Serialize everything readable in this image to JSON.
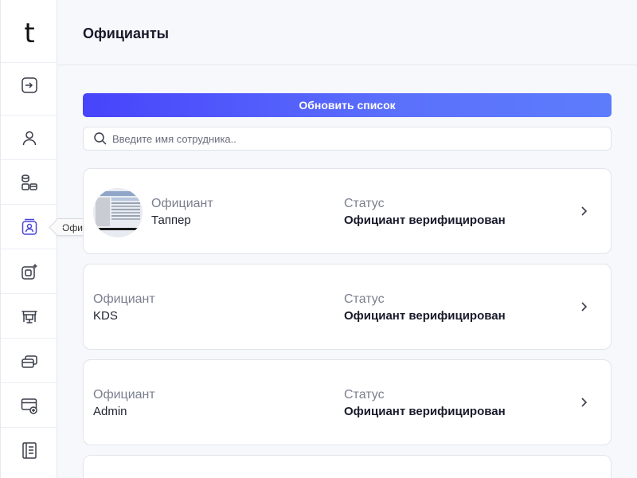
{
  "sidebar": {
    "logo": "t",
    "items": [
      {
        "icon": "logout-icon"
      },
      {
        "icon": "user-icon"
      },
      {
        "icon": "database-card-icon"
      },
      {
        "icon": "waiters-icon",
        "active": true,
        "tooltip": "Официанты"
      },
      {
        "icon": "copy-sparkle-icon"
      },
      {
        "icon": "table-icon"
      },
      {
        "icon": "cards-icon"
      },
      {
        "icon": "card-add-icon"
      },
      {
        "icon": "notebook-icon"
      }
    ]
  },
  "header": {
    "title": "Официанты"
  },
  "main": {
    "refresh_label": "Обновить список",
    "search_placeholder": "Введите имя сотрудника..",
    "waiters": [
      {
        "role_label": "Официант",
        "name": "Таппер",
        "status_label": "Статус",
        "status": "Официант верифицирован",
        "has_avatar": true
      },
      {
        "role_label": "Официант",
        "name": "KDS",
        "status_label": "Статус",
        "status": "Официант верифицирован",
        "has_avatar": false
      },
      {
        "role_label": "Официант",
        "name": "Admin",
        "status_label": "Статус",
        "status": "Официант верифицирован",
        "has_avatar": false
      }
    ]
  },
  "colors": {
    "accent_start": "#4744fb",
    "accent_end": "#5c7cfb",
    "active_icon": "#4a46d8",
    "icon": "#3a3d4a"
  }
}
